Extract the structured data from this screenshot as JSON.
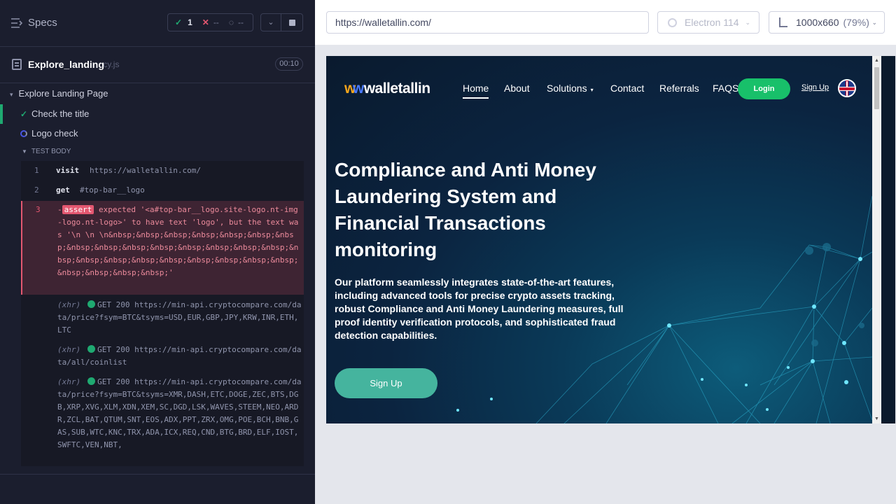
{
  "reporter": {
    "specs_label": "Specs",
    "stats": {
      "passed": "1",
      "failed": "--",
      "pending": "--"
    },
    "file": {
      "name": "Explore_landing",
      "ext": ".cy.js",
      "duration": "00:10"
    },
    "suite_title": "Explore Landing Page",
    "tests": [
      {
        "title": "Check the title",
        "state": "passed"
      },
      {
        "title": "Logo check",
        "state": "running"
      }
    ],
    "test_body_label": "TEST BODY",
    "commands": [
      {
        "num": "1",
        "name": "visit",
        "message": "https://walletallin.com/"
      },
      {
        "num": "2",
        "name": "get",
        "message": "#top-bar__logo"
      },
      {
        "num": "3",
        "name": "-assert",
        "assert_label": "assert",
        "message": "expected '<a#top-bar__logo.site-logo.nt-img-logo.nt-logo>' to have text 'logo', but the text was '\\n \\n \\n&nbsp;&nbsp;&nbsp;&nbsp;&nbsp;&nbsp;&nbsp;&nbsp;&nbsp;&nbsp;&nbsp;&nbsp;&nbsp;&nbsp;&nbsp;&nbsp;&nbsp;&nbsp;&nbsp;&nbsp;&nbsp;&nbsp;&nbsp;&nbsp;&nbsp;&nbsp;&nbsp;&nbsp;'"
      }
    ],
    "xhr_tag": "(xhr)",
    "xhr": [
      {
        "method": "GET 200",
        "url": "https://min-api.cryptocompare.com/data/price?fsym=BTC&tsyms=USD,EUR,GBP,JPY,KRW,INR,ETH,LTC"
      },
      {
        "method": "GET 200",
        "url": "https://min-api.cryptocompare.com/data/all/coinlist"
      },
      {
        "method": "GET 200",
        "url": "https://min-api.cryptocompare.com/data/price?fsym=BTC&tsyms=XMR,DASH,ETC,DOGE,ZEC,BTS,DGB,XRP,XVG,XLM,XDN,XEM,SC,DGD,LSK,WAVES,STEEM,NEO,ARDR,ZCL,BAT,QTUM,SNT,EOS,ADX,PPT,ZRX,OMG,POE,BCH,BNB,GAS,SUB,WTC,KNC,TRX,ADA,ICX,REQ,CND,BTG,BRD,ELF,IOST,SWFTC,VEN,NBT,"
      }
    ]
  },
  "browser": {
    "url": "https://walletallin.com/",
    "browser_label": "Electron 114",
    "viewport": "1000x660",
    "zoom": "(79%)"
  },
  "site": {
    "logo_text": "walletallin",
    "nav": {
      "home": "Home",
      "about": "About",
      "solutions": "Solutions",
      "contact": "Contact",
      "referrals": "Referrals",
      "faqs": "FAQS"
    },
    "login": "Login",
    "signup_link": "Sign Up",
    "hero_title": "Compliance and Anti Money Laundering System and Financial Transactions monitoring",
    "hero_sub": "Our platform seamlessly integrates state-of-the-art features, including advanced tools for precise crypto assets tracking, robust Compliance and Anti Money Laundering measures, full proof identity verification protocols, and sophisticated fraud detection capabilities.",
    "signup_button": "Sign Up"
  },
  "colors": {
    "pass": "#1fa971",
    "fail": "#e45770",
    "accent": "#18c06a",
    "button": "#45b49e"
  }
}
